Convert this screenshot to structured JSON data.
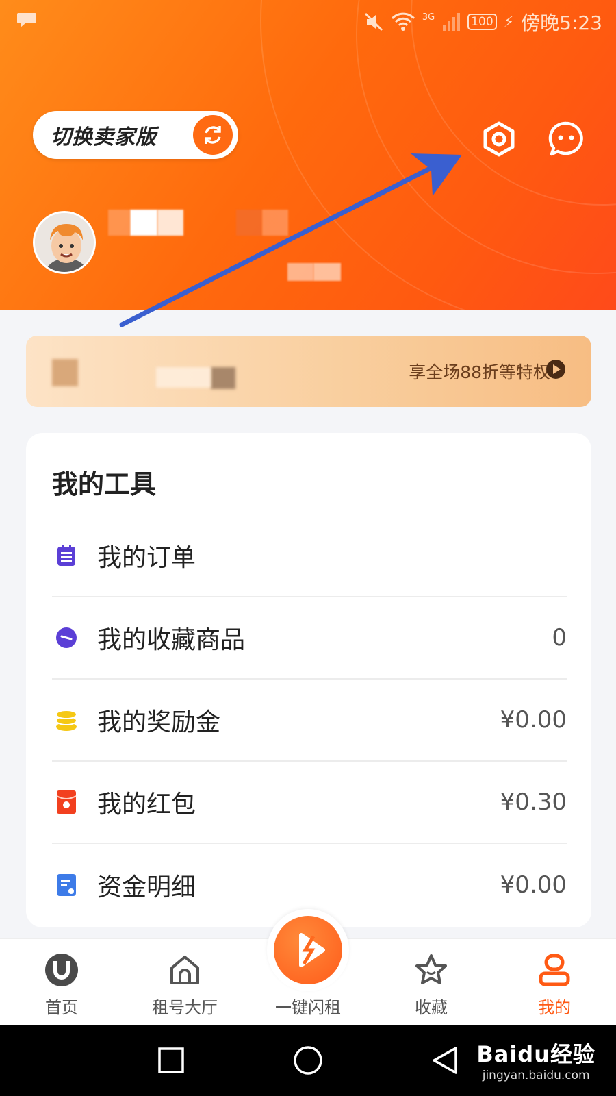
{
  "status_bar": {
    "time": "傍晚5:23",
    "battery": "100",
    "network": "3G"
  },
  "header": {
    "switch_seller_label": "切换卖家版",
    "icons": [
      "settings-icon",
      "message-icon"
    ]
  },
  "vip_banner": {
    "benefit_text": "享全场88折等特权"
  },
  "tools": {
    "title": "我的工具",
    "items": [
      {
        "label": "我的订单",
        "value": "",
        "icon": "order-icon",
        "color": "#5b3fd6"
      },
      {
        "label": "我的收藏商品",
        "value": "0",
        "icon": "favorite-goods-icon",
        "color": "#5b3fd6"
      },
      {
        "label": "我的奖励金",
        "value": "¥0.00",
        "icon": "coins-icon",
        "color": "#f5c814"
      },
      {
        "label": "我的红包",
        "value": "¥0.30",
        "icon": "red-packet-icon",
        "color": "#f2401f"
      },
      {
        "label": "资金明细",
        "value": "¥0.00",
        "icon": "funds-detail-icon",
        "color": "#3d7be8"
      }
    ]
  },
  "tabbar": {
    "tabs": [
      {
        "label": "首页",
        "icon": "home-u-icon"
      },
      {
        "label": "租号大厅",
        "icon": "house-icon"
      },
      {
        "label": "一键闪租",
        "icon": "flash-rent-icon"
      },
      {
        "label": "收藏",
        "icon": "star-icon"
      },
      {
        "label": "我的",
        "icon": "profile-icon"
      }
    ],
    "active": "我的"
  },
  "watermark": {
    "main": "Baidu经验",
    "sub": "jingyan.baidu.com"
  },
  "colors": {
    "accent": "#ff5a14",
    "header_start": "#ff8c1a",
    "annotation_arrow": "#3a5fd0"
  }
}
